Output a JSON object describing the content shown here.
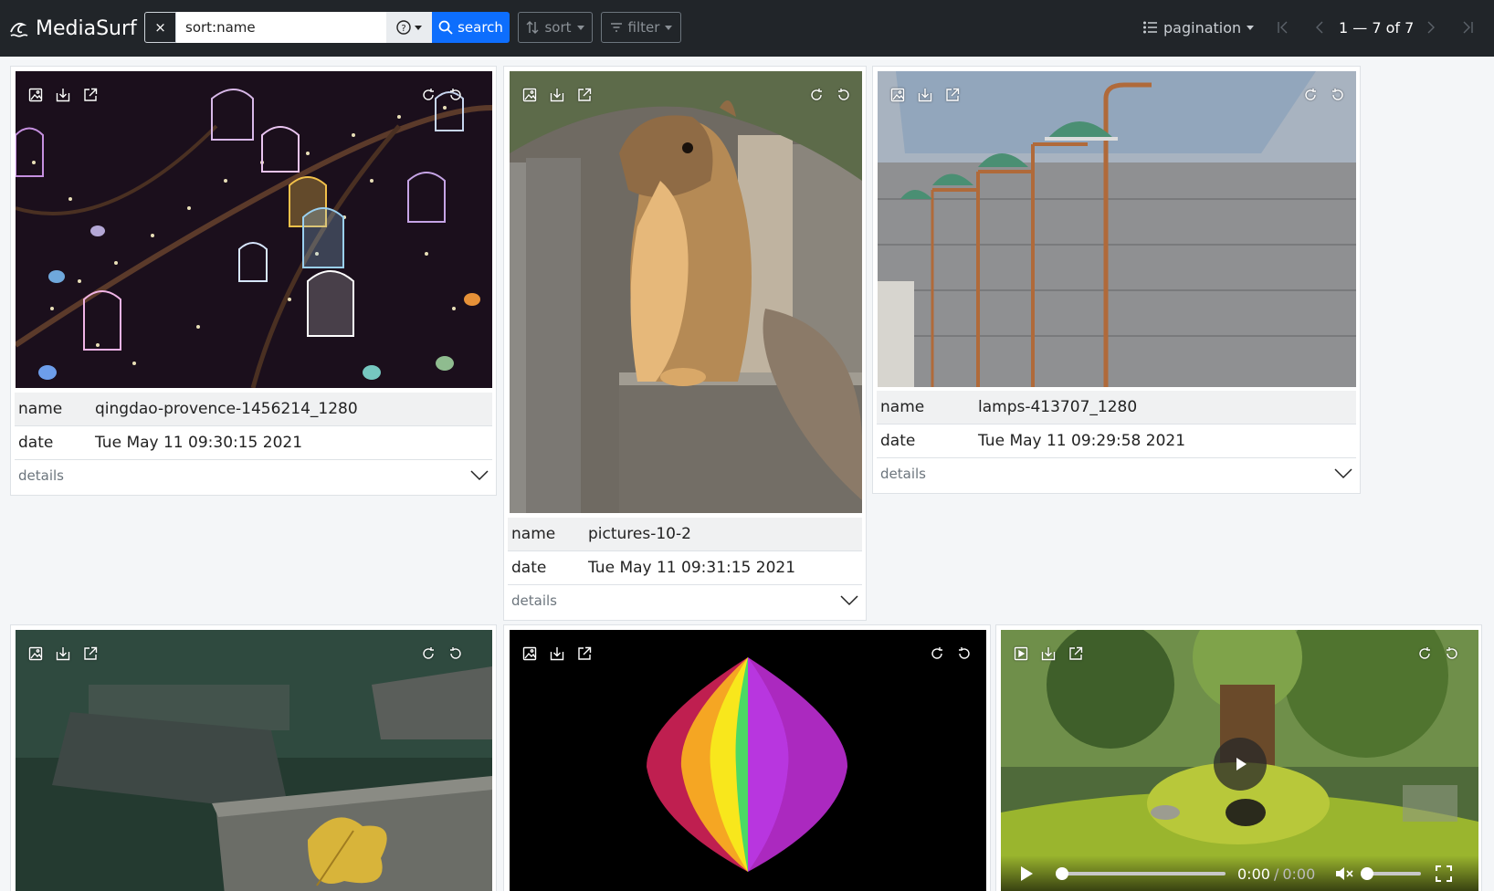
{
  "app": {
    "title": "MediaSurf"
  },
  "search": {
    "clear_label": "×",
    "value": "sort:name",
    "help_label": "?",
    "button_label": "search"
  },
  "toolbar": {
    "sort_label": "sort",
    "filter_label": "filter",
    "pagination_label": "pagination",
    "page_info": "1 — 7 of 7"
  },
  "labels": {
    "name": "name",
    "date": "date",
    "details": "details"
  },
  "cards": [
    {
      "name": "qingdao-provence-1456214_1280",
      "date": "Tue May 11 09:30:15 2021",
      "media_icon": "image-icon"
    },
    {
      "name": "pictures-10-2",
      "date": "Tue May 11 09:31:15 2021",
      "media_icon": "image-icon"
    },
    {
      "name": "lamps-413707_1280",
      "date": "Tue May 11 09:29:58 2021",
      "media_icon": "image-icon"
    },
    {
      "media_icon": "image-icon"
    },
    {
      "media_icon": "image-icon"
    },
    {
      "media_icon": "video-icon"
    }
  ],
  "video": {
    "current_time": "0:00",
    "separator": "/",
    "duration": "0:00"
  },
  "colors": {
    "navbar": "#212529",
    "accent": "#0d6efd",
    "page_bg": "#f4f6f8"
  }
}
